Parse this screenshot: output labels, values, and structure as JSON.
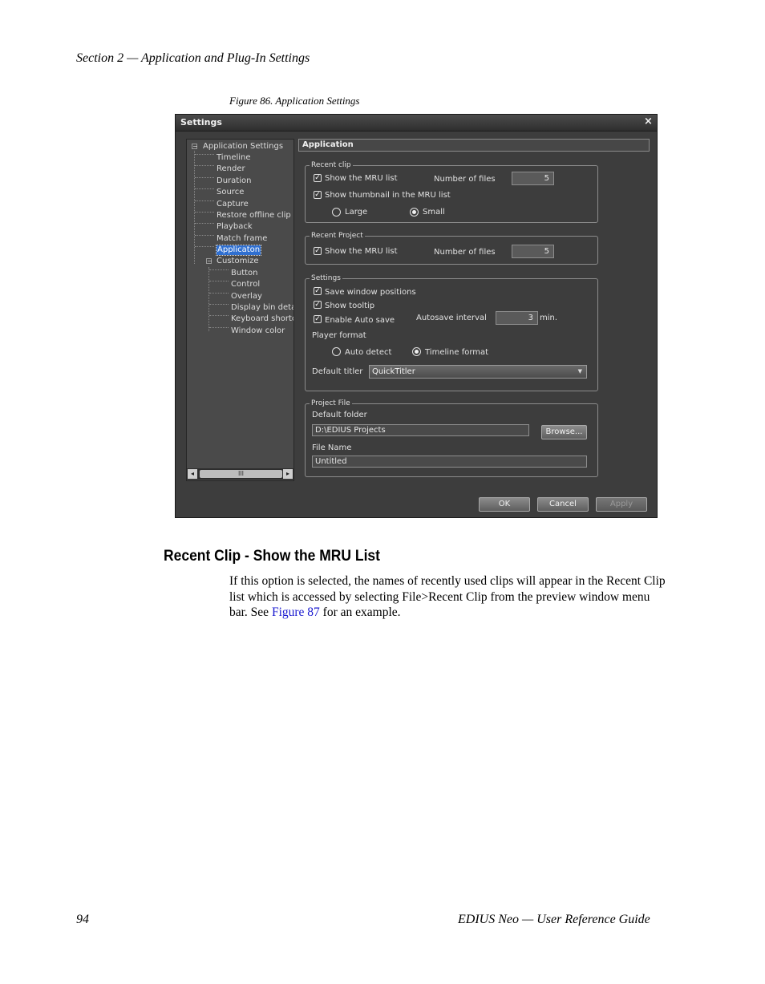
{
  "page": {
    "header": "Section 2 — Application and Plug-In Settings",
    "figure_caption": "Figure 86.  Application Settings",
    "footer_page": "94",
    "footer_title": "EDIUS Neo  —  User Reference Guide"
  },
  "dialog": {
    "title": "Settings",
    "close": "×",
    "tree": {
      "root": "Application Settings",
      "root_toggle": "−",
      "items": [
        "Timeline",
        "Render",
        "Duration",
        "Source",
        "Capture",
        "Restore offline clip",
        "Playback",
        "Match frame",
        "Applicaton"
      ],
      "customize": "Customize",
      "customize_toggle": "−",
      "customize_items": [
        "Button",
        "Control",
        "Overlay",
        "Display bin details",
        "Keyboard shortcut",
        "Window color"
      ],
      "scroll_left": "◂",
      "scroll_right": "▸",
      "scroll_grip": "III"
    },
    "panel_title": "Application",
    "recent_clip": {
      "label": "Recent clip",
      "show_mru": "Show the MRU list",
      "num_files_label": "Number of files",
      "num_files": "5",
      "show_thumb": "Show thumbnail in the MRU list",
      "large": "Large",
      "small": "Small"
    },
    "recent_project": {
      "label": "Recent Project",
      "show_mru": "Show the MRU list",
      "num_files_label": "Number of files",
      "num_files": "5"
    },
    "settings": {
      "label": "Settings",
      "save_window": "Save window positions",
      "show_tooltip": "Show tooltip",
      "enable_autosave": "Enable Auto save",
      "autosave_label": "Autosave interval",
      "autosave_value": "3",
      "autosave_unit": "min.",
      "player_format": "Player format",
      "auto_detect": "Auto detect",
      "timeline_format": "Timeline format",
      "default_titler_label": "Default titler",
      "default_titler": "QuickTitler"
    },
    "project_file": {
      "label": "Project File",
      "default_folder_label": "Default folder",
      "default_folder": "D:\\EDIUS Projects",
      "browse": "Browse...",
      "file_name_label": "File Name",
      "file_name": "Untitled"
    },
    "buttons": {
      "ok": "OK",
      "cancel": "Cancel",
      "apply": "Apply"
    },
    "check_glyph": "✓"
  },
  "section": {
    "title": "Recent Clip - Show the MRU List",
    "para_before": "If this option is selected, the names of recently used clips will appear in the Recent Clip list which is accessed by selecting File>Recent Clip from the preview window menu bar. See ",
    "link": "Figure 87",
    "para_after": " for an example."
  }
}
